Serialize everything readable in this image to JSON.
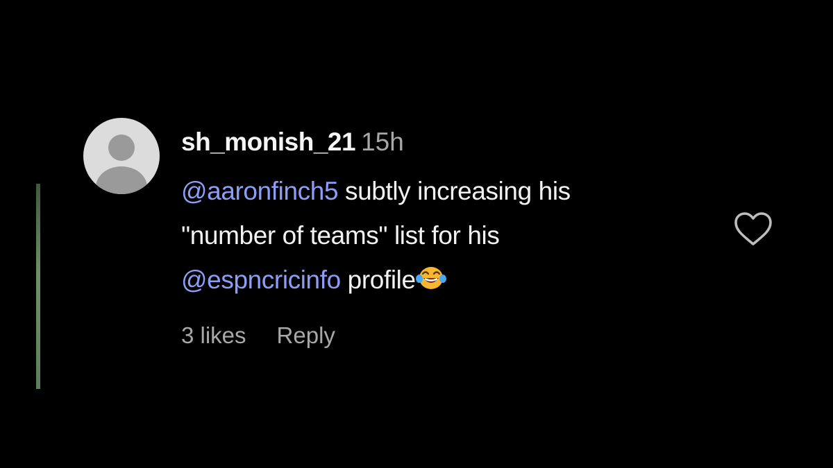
{
  "comment": {
    "username": "sh_monish_21",
    "timestamp": "15h",
    "mention_1": "@aaronfinch5",
    "text_1": " subtly increasing his",
    "text_2": "\"number of teams\" list for his",
    "mention_2": "@espncricinfo",
    "text_3": " profile",
    "emoji": "face-with-tears-of-joy",
    "likes_label": "3 likes",
    "reply_label": "Reply",
    "like_icon": "heart-icon",
    "avatar_icon": "default-avatar-icon"
  },
  "colors": {
    "background": "#000000",
    "text": "#f2f2f2",
    "muted": "#a8a8a8",
    "mention": "#8e9ef5",
    "thread_line": "#6f8f69"
  }
}
